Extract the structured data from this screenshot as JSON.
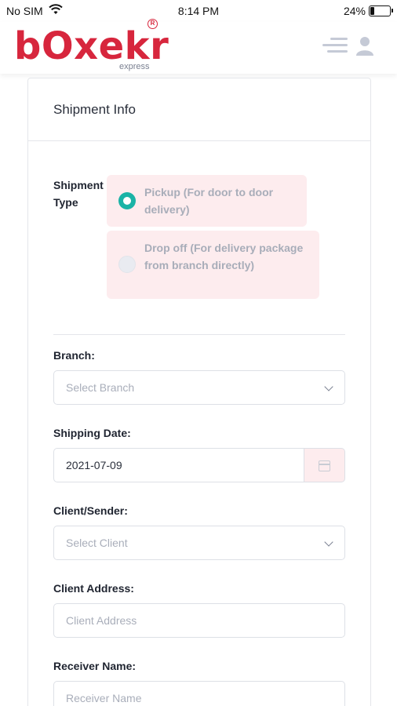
{
  "status_bar": {
    "carrier": "No SIM",
    "time": "8:14 PM",
    "battery_percent": "24%",
    "battery_level": 0.24,
    "wifi_icon": "wifi-icon"
  },
  "header": {
    "logo_text": "bΟxekr",
    "logo_subtext": "express",
    "logo_registered": "R",
    "brand_color": "#d7263d",
    "menu_icon": "menu-icon",
    "user_icon": "user-icon"
  },
  "card": {
    "title": "Shipment Info",
    "shipment_type": {
      "label": "Shipment Type",
      "options": [
        {
          "label": "Pickup (For door to door delivery)",
          "selected": true
        },
        {
          "label": "Drop off (For delivery package from branch directly)",
          "selected": false
        }
      ],
      "accent_color": "#1ab3a6"
    },
    "fields": {
      "branch": {
        "label": "Branch:",
        "placeholder": "Select Branch"
      },
      "shipping_date": {
        "label": "Shipping Date:",
        "value": "2021-07-09"
      },
      "client": {
        "label": "Client/Sender:",
        "placeholder": "Select Client"
      },
      "client_address": {
        "label": "Client Address:",
        "placeholder": "Client Address"
      },
      "receiver_name": {
        "label": "Receiver Name:",
        "placeholder": "Receiver Name"
      }
    }
  }
}
